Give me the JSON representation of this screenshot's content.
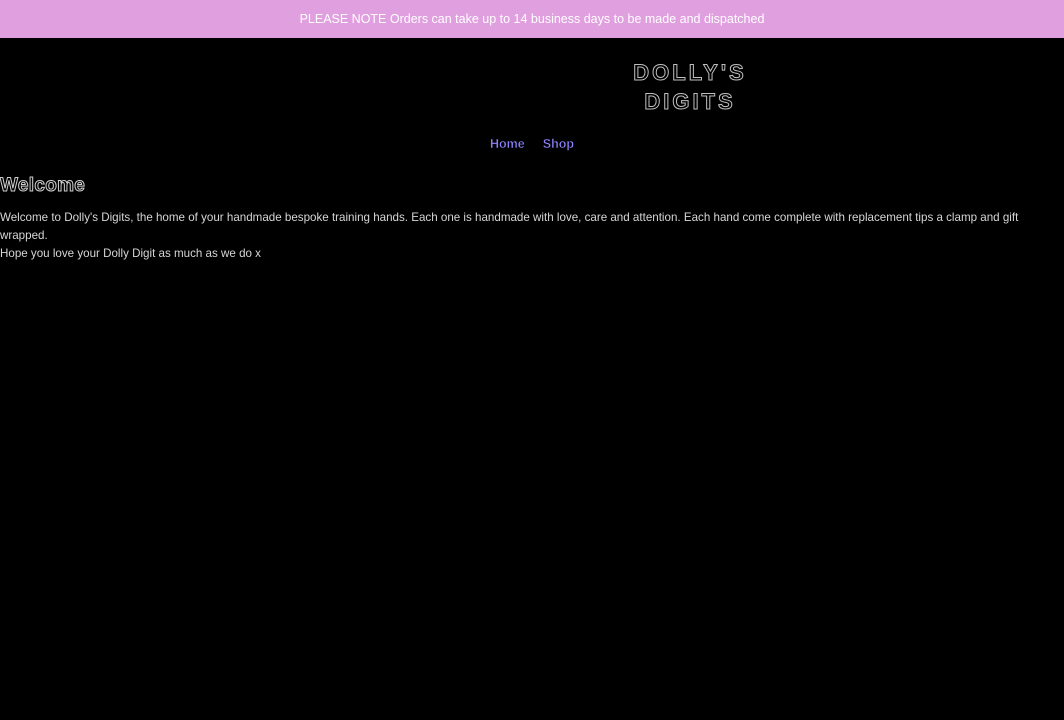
{
  "announcement": {
    "text": "PLEASE NOTE Orders can take up to 14 business days to be made and dispatched"
  },
  "logo": {
    "line1": "DOLLY'S",
    "line2": "DIGITS"
  },
  "nav": {
    "items": [
      {
        "label": "Home"
      },
      {
        "label": "Shop"
      }
    ]
  },
  "main": {
    "title": "Welcome",
    "paragraph1": "Welcome to Dolly's Digits, the home of your handmade bespoke training hands. Each one is handmade with love, care and attention. Each hand come complete with replacement tips a clamp and gift wrapped.",
    "paragraph2": "Hope you love your Dolly Digit as much as we do x"
  },
  "colors": {
    "announcement_bg": "#e09fdf",
    "page_bg": "#000000",
    "nav_link": "#8f84ff"
  }
}
